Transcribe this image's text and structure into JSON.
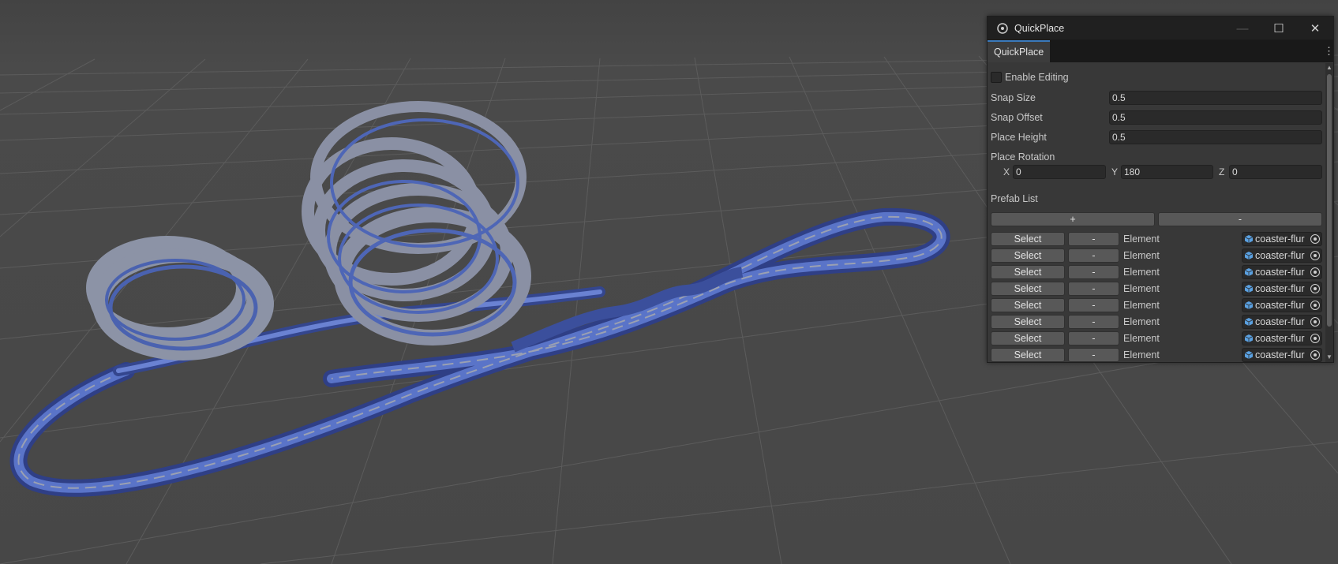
{
  "window": {
    "title": "QuickPlace",
    "tab": "QuickPlace",
    "controls": {
      "minimize": "—",
      "maximize": "☐",
      "close": "✕"
    }
  },
  "fields": {
    "enable_editing": {
      "label": "Enable Editing",
      "checked": false
    },
    "snap_size": {
      "label": "Snap Size",
      "value": "0.5"
    },
    "snap_offset": {
      "label": "Snap Offset",
      "value": "0.5"
    },
    "place_height": {
      "label": "Place Height",
      "value": "0.5"
    },
    "place_rotation": {
      "label": "Place Rotation",
      "x_label": "X",
      "x": "0",
      "y_label": "Y",
      "y": "180",
      "z_label": "Z",
      "z": "0"
    }
  },
  "prefab_list": {
    "label": "Prefab List",
    "add_label": "+",
    "remove_label": "-",
    "rows": [
      {
        "select": "Select",
        "remove": "-",
        "element": "Element",
        "object": "coaster-flur"
      },
      {
        "select": "Select",
        "remove": "-",
        "element": "Element",
        "object": "coaster-flur"
      },
      {
        "select": "Select",
        "remove": "-",
        "element": "Element",
        "object": "coaster-flur"
      },
      {
        "select": "Select",
        "remove": "-",
        "element": "Element",
        "object": "coaster-flur"
      },
      {
        "select": "Select",
        "remove": "-",
        "element": "Element",
        "object": "coaster-flur"
      },
      {
        "select": "Select",
        "remove": "-",
        "element": "Element",
        "object": "coaster-flur"
      },
      {
        "select": "Select",
        "remove": "-",
        "element": "Element",
        "object": "coaster-flur"
      },
      {
        "select": "Select",
        "remove": "-",
        "element": "Element",
        "object": "coaster-flur"
      }
    ]
  },
  "colors": {
    "viewport_bg": "#474747",
    "grid_line": "#5a5a5a",
    "track_rail": "#8a8f9e",
    "track_surface": "#4a62b0",
    "panel_bg": "#383838",
    "button": "#585858"
  }
}
